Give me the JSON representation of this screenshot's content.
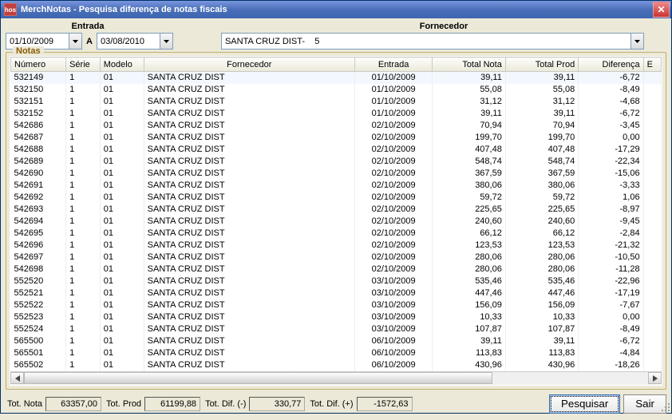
{
  "window": {
    "title": "MerchNotas - Pesquisa diferença de notas fiscais",
    "icon_label": "hos"
  },
  "filters": {
    "entrada_label": "Entrada",
    "fornecedor_label": "Fornecedor",
    "date_from": "01/10/2009",
    "date_sep": "A",
    "date_to": "03/08/2010",
    "fornecedor_value": "SANTA CRUZ DIST-    5"
  },
  "notas": {
    "legend": "Notas",
    "columns": [
      "Número",
      "Série",
      "Modelo",
      "Fornecedor",
      "Entrada",
      "Total Nota",
      "Total Prod",
      "Diferença",
      "E"
    ],
    "rows": [
      {
        "numero": "532149",
        "serie": "1",
        "modelo": "01",
        "fornecedor": "SANTA CRUZ DIST",
        "entrada": "01/10/2009",
        "total_nota": "39,11",
        "total_prod": "39,11",
        "diferenca": "-6,72"
      },
      {
        "numero": "532150",
        "serie": "1",
        "modelo": "01",
        "fornecedor": "SANTA CRUZ DIST",
        "entrada": "01/10/2009",
        "total_nota": "55,08",
        "total_prod": "55,08",
        "diferenca": "-8,49"
      },
      {
        "numero": "532151",
        "serie": "1",
        "modelo": "01",
        "fornecedor": "SANTA CRUZ DIST",
        "entrada": "01/10/2009",
        "total_nota": "31,12",
        "total_prod": "31,12",
        "diferenca": "-4,68"
      },
      {
        "numero": "532152",
        "serie": "1",
        "modelo": "01",
        "fornecedor": "SANTA CRUZ DIST",
        "entrada": "01/10/2009",
        "total_nota": "39,11",
        "total_prod": "39,11",
        "diferenca": "-6,72"
      },
      {
        "numero": "542686",
        "serie": "1",
        "modelo": "01",
        "fornecedor": "SANTA CRUZ DIST",
        "entrada": "02/10/2009",
        "total_nota": "70,94",
        "total_prod": "70,94",
        "diferenca": "-3,45"
      },
      {
        "numero": "542687",
        "serie": "1",
        "modelo": "01",
        "fornecedor": "SANTA CRUZ DIST",
        "entrada": "02/10/2009",
        "total_nota": "199,70",
        "total_prod": "199,70",
        "diferenca": "0,00"
      },
      {
        "numero": "542688",
        "serie": "1",
        "modelo": "01",
        "fornecedor": "SANTA CRUZ DIST",
        "entrada": "02/10/2009",
        "total_nota": "407,48",
        "total_prod": "407,48",
        "diferenca": "-17,29"
      },
      {
        "numero": "542689",
        "serie": "1",
        "modelo": "01",
        "fornecedor": "SANTA CRUZ DIST",
        "entrada": "02/10/2009",
        "total_nota": "548,74",
        "total_prod": "548,74",
        "diferenca": "-22,34"
      },
      {
        "numero": "542690",
        "serie": "1",
        "modelo": "01",
        "fornecedor": "SANTA CRUZ DIST",
        "entrada": "02/10/2009",
        "total_nota": "367,59",
        "total_prod": "367,59",
        "diferenca": "-15,06"
      },
      {
        "numero": "542691",
        "serie": "1",
        "modelo": "01",
        "fornecedor": "SANTA CRUZ DIST",
        "entrada": "02/10/2009",
        "total_nota": "380,06",
        "total_prod": "380,06",
        "diferenca": "-3,33"
      },
      {
        "numero": "542692",
        "serie": "1",
        "modelo": "01",
        "fornecedor": "SANTA CRUZ DIST",
        "entrada": "02/10/2009",
        "total_nota": "59,72",
        "total_prod": "59,72",
        "diferenca": "1,06"
      },
      {
        "numero": "542693",
        "serie": "1",
        "modelo": "01",
        "fornecedor": "SANTA CRUZ DIST",
        "entrada": "02/10/2009",
        "total_nota": "225,65",
        "total_prod": "225,65",
        "diferenca": "-8,97"
      },
      {
        "numero": "542694",
        "serie": "1",
        "modelo": "01",
        "fornecedor": "SANTA CRUZ DIST",
        "entrada": "02/10/2009",
        "total_nota": "240,60",
        "total_prod": "240,60",
        "diferenca": "-9,45"
      },
      {
        "numero": "542695",
        "serie": "1",
        "modelo": "01",
        "fornecedor": "SANTA CRUZ DIST",
        "entrada": "02/10/2009",
        "total_nota": "66,12",
        "total_prod": "66,12",
        "diferenca": "-2,84"
      },
      {
        "numero": "542696",
        "serie": "1",
        "modelo": "01",
        "fornecedor": "SANTA CRUZ DIST",
        "entrada": "02/10/2009",
        "total_nota": "123,53",
        "total_prod": "123,53",
        "diferenca": "-21,32"
      },
      {
        "numero": "542697",
        "serie": "1",
        "modelo": "01",
        "fornecedor": "SANTA CRUZ DIST",
        "entrada": "02/10/2009",
        "total_nota": "280,06",
        "total_prod": "280,06",
        "diferenca": "-10,50"
      },
      {
        "numero": "542698",
        "serie": "1",
        "modelo": "01",
        "fornecedor": "SANTA CRUZ DIST",
        "entrada": "02/10/2009",
        "total_nota": "280,06",
        "total_prod": "280,06",
        "diferenca": "-11,28"
      },
      {
        "numero": "552520",
        "serie": "1",
        "modelo": "01",
        "fornecedor": "SANTA CRUZ DIST",
        "entrada": "03/10/2009",
        "total_nota": "535,46",
        "total_prod": "535,46",
        "diferenca": "-22,96"
      },
      {
        "numero": "552521",
        "serie": "1",
        "modelo": "01",
        "fornecedor": "SANTA CRUZ DIST",
        "entrada": "03/10/2009",
        "total_nota": "447,46",
        "total_prod": "447,46",
        "diferenca": "-17,19"
      },
      {
        "numero": "552522",
        "serie": "1",
        "modelo": "01",
        "fornecedor": "SANTA CRUZ DIST",
        "entrada": "03/10/2009",
        "total_nota": "156,09",
        "total_prod": "156,09",
        "diferenca": "-7,67"
      },
      {
        "numero": "552523",
        "serie": "1",
        "modelo": "01",
        "fornecedor": "SANTA CRUZ DIST",
        "entrada": "03/10/2009",
        "total_nota": "10,33",
        "total_prod": "10,33",
        "diferenca": "0,00"
      },
      {
        "numero": "552524",
        "serie": "1",
        "modelo": "01",
        "fornecedor": "SANTA CRUZ DIST",
        "entrada": "03/10/2009",
        "total_nota": "107,87",
        "total_prod": "107,87",
        "diferenca": "-8,49"
      },
      {
        "numero": "565500",
        "serie": "1",
        "modelo": "01",
        "fornecedor": "SANTA CRUZ DIST",
        "entrada": "06/10/2009",
        "total_nota": "39,11",
        "total_prod": "39,11",
        "diferenca": "-6,72"
      },
      {
        "numero": "565501",
        "serie": "1",
        "modelo": "01",
        "fornecedor": "SANTA CRUZ DIST",
        "entrada": "06/10/2009",
        "total_nota": "113,83",
        "total_prod": "113,83",
        "diferenca": "-4,84"
      },
      {
        "numero": "565502",
        "serie": "1",
        "modelo": "01",
        "fornecedor": "SANTA CRUZ DIST",
        "entrada": "06/10/2009",
        "total_nota": "430,96",
        "total_prod": "430,96",
        "diferenca": "-18,26"
      }
    ]
  },
  "totals": {
    "tot_nota_label": "Tot. Nota",
    "tot_nota": "63357,00",
    "tot_prod_label": "Tot. Prod",
    "tot_prod": "61199,88",
    "tot_dif_neg_label": "Tot. Dif. (-)",
    "tot_dif_neg": "330,77",
    "tot_dif_pos_label": "Tot. Dif. (+)",
    "tot_dif_pos": "-1572,63"
  },
  "buttons": {
    "pesquisar": "Pesquisar",
    "sair": "Sair"
  }
}
